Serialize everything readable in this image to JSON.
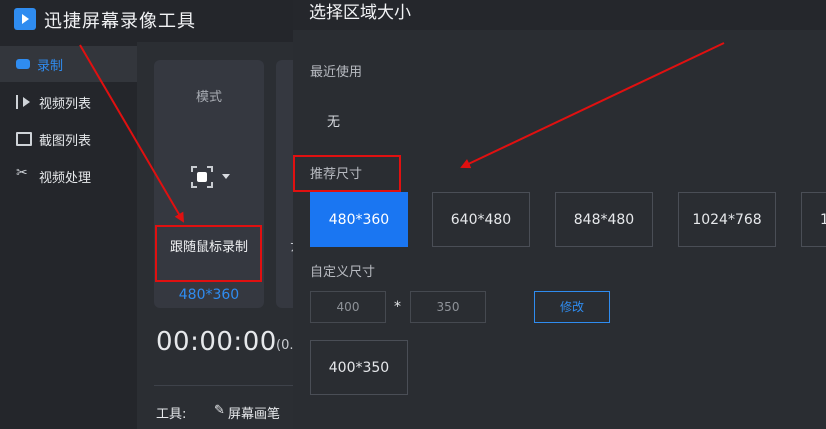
{
  "app": {
    "title": "迅捷屏幕录像工具",
    "logo_icon": "video-record-icon"
  },
  "sidebar": {
    "items": [
      {
        "label": "录制",
        "icon": "camera-icon",
        "active": true
      },
      {
        "label": "视频列表",
        "icon": "video-list-icon",
        "active": false
      },
      {
        "label": "截图列表",
        "icon": "screenshot-list-icon",
        "active": false
      },
      {
        "label": "视频处理",
        "icon": "video-tools-icon",
        "active": false
      }
    ]
  },
  "recorder": {
    "mode_title": "模式",
    "mode_label": "跟随鼠标录制",
    "resolution": "480*360",
    "second_card_label": "ﾌ",
    "timer": "00:00:00",
    "timer_sub": "(0.0",
    "tools_label": "工具:",
    "pen_label": "屏幕画笔"
  },
  "dialog": {
    "title": "选择区域大小",
    "recent_label": "最近使用",
    "recent_none": "无",
    "recommended_label": "推荐尺寸",
    "sizes": [
      "480*360",
      "640*480",
      "848*480",
      "1024*768",
      "1"
    ],
    "selected_size": "480*360",
    "custom_label": "自定义尺寸",
    "custom_width": "400",
    "custom_height": "350",
    "times_sign": "*",
    "modify_label": "修改",
    "custom_result": "400*350"
  },
  "colors": {
    "accent": "#1a76f2",
    "annotation": "#e01010",
    "background": "#2b2e33"
  }
}
